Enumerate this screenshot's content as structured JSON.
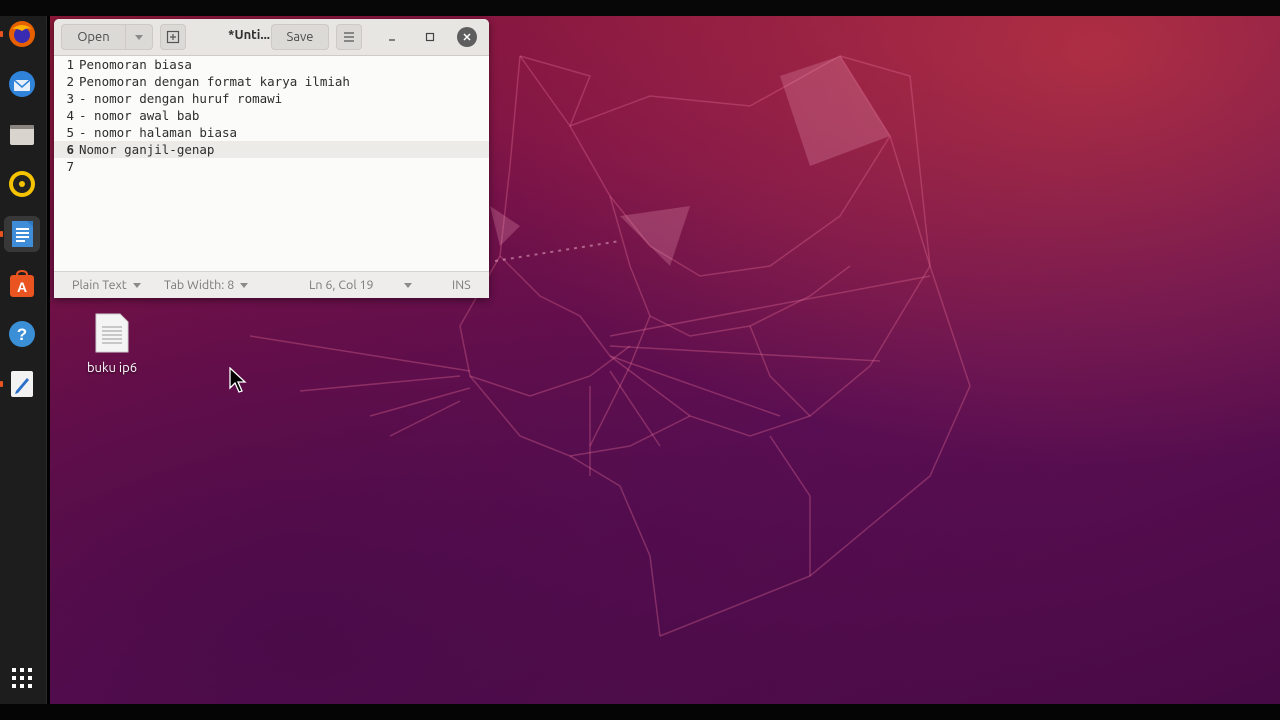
{
  "dock": {
    "apps": [
      {
        "icon": "firefox-icon"
      },
      {
        "icon": "thunderbird-icon"
      },
      {
        "icon": "files-icon"
      },
      {
        "icon": "rhythmbox-icon"
      },
      {
        "icon": "libreoffice-writer-icon"
      },
      {
        "icon": "ubuntu-software-icon"
      },
      {
        "icon": "help-icon"
      },
      {
        "icon": "text-editor-icon"
      }
    ],
    "show_apps_icon": "grid-icon"
  },
  "window": {
    "title": "*Unti...",
    "open_label": "Open",
    "save_label": "Save"
  },
  "editor": {
    "lines": [
      {
        "n": "1",
        "text": "Penomoran biasa"
      },
      {
        "n": "2",
        "text": "Penomoran dengan format karya ilmiah"
      },
      {
        "n": "3",
        "text": "- nomor dengan huruf romawi"
      },
      {
        "n": "4",
        "text": "- nomor awal bab"
      },
      {
        "n": "5",
        "text": "- nomor halaman biasa"
      },
      {
        "n": "6",
        "text": "Nomor ganjil-genap"
      },
      {
        "n": "7",
        "text": ""
      }
    ],
    "current_line": 6
  },
  "statusbar": {
    "language": "Plain Text",
    "tab_width": "Tab Width: 8",
    "position": "Ln 6, Col 19",
    "mode": "INS"
  },
  "desktop": {
    "file_label": "buku ip6"
  },
  "colors": {
    "accent": "#e95420",
    "wallpaper_top": "#8c1838",
    "wallpaper_bottom": "#470a45",
    "dock_bg": "#1d1d1d"
  }
}
